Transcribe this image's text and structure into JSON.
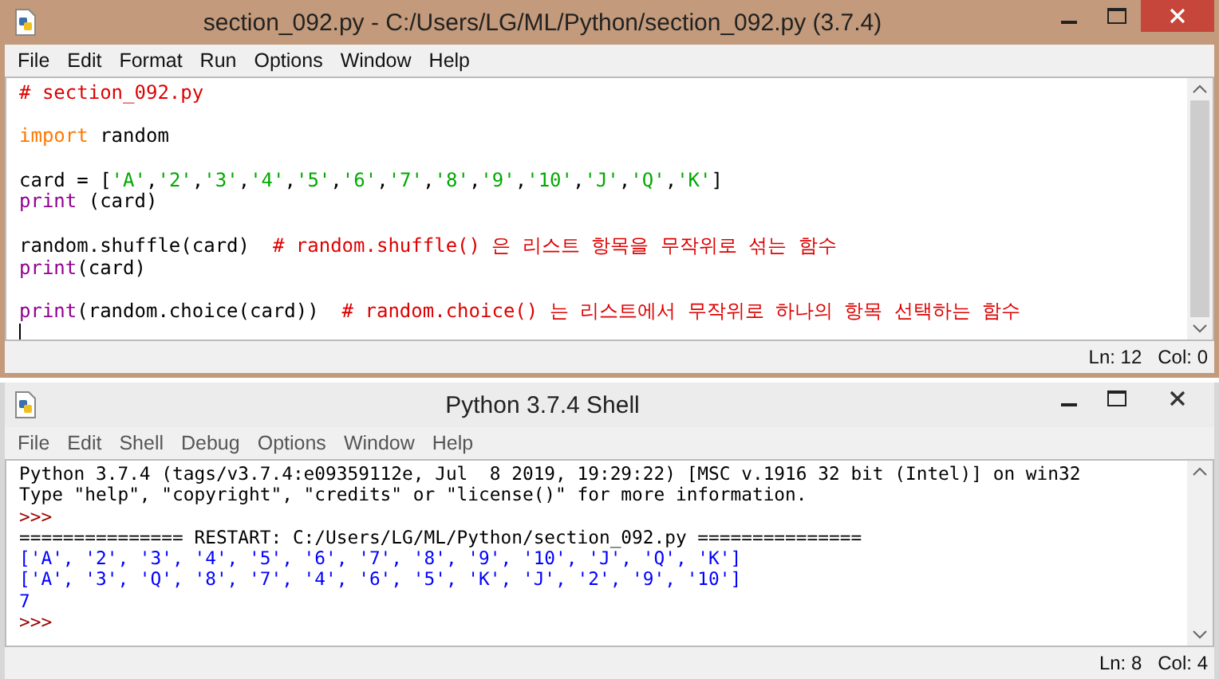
{
  "windows": [
    {
      "kind": "editor",
      "title": "section_092.py - C:/Users/LG/ML/Python/section_092.py (3.7.4)",
      "active": true,
      "menu": [
        "File",
        "Edit",
        "Format",
        "Run",
        "Options",
        "Window",
        "Help"
      ],
      "lines": [
        {
          "spaced": false,
          "segments": [
            {
              "kind": "comment",
              "text": "# section_092.py"
            }
          ]
        },
        {
          "spaced": true,
          "segments": [
            {
              "kind": "keyword",
              "text": "import"
            },
            {
              "kind": "plain",
              "text": " random"
            }
          ]
        },
        {
          "spaced": true,
          "segments": [
            {
              "kind": "plain",
              "text": "card = ["
            },
            {
              "kind": "string",
              "text": "'A'"
            },
            {
              "kind": "plain",
              "text": ","
            },
            {
              "kind": "string",
              "text": "'2'"
            },
            {
              "kind": "plain",
              "text": ","
            },
            {
              "kind": "string",
              "text": "'3'"
            },
            {
              "kind": "plain",
              "text": ","
            },
            {
              "kind": "string",
              "text": "'4'"
            },
            {
              "kind": "plain",
              "text": ","
            },
            {
              "kind": "string",
              "text": "'5'"
            },
            {
              "kind": "plain",
              "text": ","
            },
            {
              "kind": "string",
              "text": "'6'"
            },
            {
              "kind": "plain",
              "text": ","
            },
            {
              "kind": "string",
              "text": "'7'"
            },
            {
              "kind": "plain",
              "text": ","
            },
            {
              "kind": "string",
              "text": "'8'"
            },
            {
              "kind": "plain",
              "text": ","
            },
            {
              "kind": "string",
              "text": "'9'"
            },
            {
              "kind": "plain",
              "text": ","
            },
            {
              "kind": "string",
              "text": "'10'"
            },
            {
              "kind": "plain",
              "text": ","
            },
            {
              "kind": "string",
              "text": "'J'"
            },
            {
              "kind": "plain",
              "text": ","
            },
            {
              "kind": "string",
              "text": "'Q'"
            },
            {
              "kind": "plain",
              "text": ","
            },
            {
              "kind": "string",
              "text": "'K'"
            },
            {
              "kind": "plain",
              "text": "]"
            }
          ]
        },
        {
          "spaced": false,
          "segments": [
            {
              "kind": "builtin",
              "text": "print"
            },
            {
              "kind": "plain",
              "text": " (card)"
            }
          ]
        },
        {
          "spaced": true,
          "segments": [
            {
              "kind": "plain",
              "text": "random.shuffle(card)  "
            },
            {
              "kind": "comment",
              "text": "# random.shuffle() 은 리스트 항목을 무작위로 섞는 함수"
            }
          ]
        },
        {
          "spaced": false,
          "segments": [
            {
              "kind": "builtin",
              "text": "print"
            },
            {
              "kind": "plain",
              "text": "(card)"
            }
          ]
        },
        {
          "spaced": true,
          "segments": [
            {
              "kind": "builtin",
              "text": "print"
            },
            {
              "kind": "plain",
              "text": "(random.choice(card))  "
            },
            {
              "kind": "comment",
              "text": "# random.choice() 는 리스트에서 무작위로 하나의 항목 선택하는 함수"
            }
          ]
        }
      ],
      "caret_visible": true,
      "status": [
        "Ln: 12",
        "Col: 0"
      ]
    },
    {
      "kind": "shell",
      "title": "Python 3.7.4 Shell",
      "active": false,
      "menu": [
        "File",
        "Edit",
        "Shell",
        "Debug",
        "Options",
        "Window",
        "Help"
      ],
      "lines": [
        {
          "segments": [
            {
              "kind": "plain",
              "text": "Python 3.7.4 (tags/v3.7.4:e09359112e, Jul  8 2019, 19:29:22) [MSC v.1916 32 bit (Intel)] on win32"
            }
          ]
        },
        {
          "segments": [
            {
              "kind": "plain",
              "text": "Type \"help\", \"copyright\", \"credits\" or \"license()\" for more information."
            }
          ]
        },
        {
          "segments": [
            {
              "kind": "prompt",
              "text": ">>>"
            }
          ]
        },
        {
          "segments": [
            {
              "kind": "plain",
              "text": "=============== RESTART: C:/Users/LG/ML/Python/section_092.py ==============="
            }
          ]
        },
        {
          "segments": [
            {
              "kind": "stdout",
              "text": "['A', '2', '3', '4', '5', '6', '7', '8', '9', '10', 'J', 'Q', 'K']"
            }
          ]
        },
        {
          "segments": [
            {
              "kind": "stdout",
              "text": "['A', '3', 'Q', '8', '7', '4', '6', '5', 'K', 'J', '2', '9', '10']"
            }
          ]
        },
        {
          "segments": [
            {
              "kind": "stdout",
              "text": "7"
            }
          ]
        },
        {
          "segments": [
            {
              "kind": "prompt",
              "text": ">>>"
            }
          ]
        }
      ],
      "status": [
        "Ln: 8",
        "Col: 4"
      ]
    }
  ]
}
